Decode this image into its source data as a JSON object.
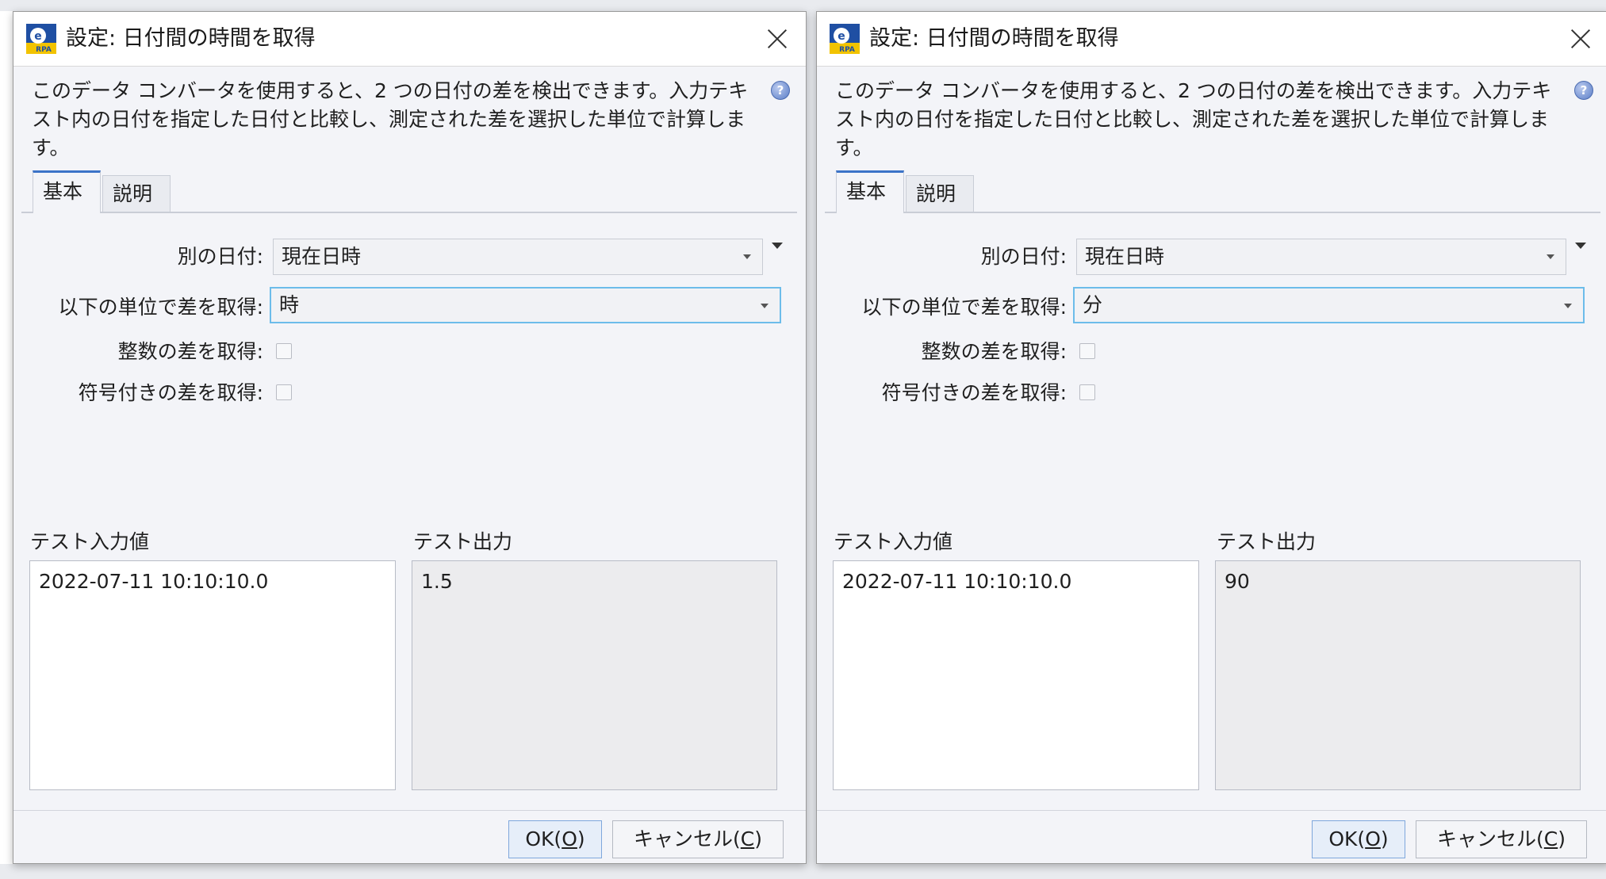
{
  "dialogs": [
    {
      "title": "設定: 日付間の時間を取得",
      "description": "このデータ コンバータを使用すると、2 つの日付の差を検出できます。入力テキスト内の日付を指定した日付と比較し、測定された差を選択した単位で計算します。",
      "tabs": [
        {
          "label": "基本",
          "active": true
        },
        {
          "label": "説明",
          "active": false
        }
      ],
      "other_date_label": "別の日付:",
      "other_date_value": "現在日時",
      "unit_label": "以下の単位で差を取得:",
      "unit_value": "時",
      "integer_diff_label": "整数の差を取得:",
      "integer_diff_checked": false,
      "signed_diff_label": "符号付きの差を取得:",
      "signed_diff_checked": false,
      "test_input_label": "テスト入力値",
      "test_input_value": "2022-07-11 10:10:10.0",
      "test_output_label": "テスト出力",
      "test_output_value": "1.5",
      "ok_label": "OK(",
      "ok_mnemonic": "O",
      "ok_suffix": ")",
      "cancel_label": "キャンセル(",
      "cancel_mnemonic": "C",
      "cancel_suffix": ")"
    },
    {
      "title": "設定: 日付間の時間を取得",
      "description": "このデータ コンバータを使用すると、2 つの日付の差を検出できます。入力テキスト内の日付を指定した日付と比較し、測定された差を選択した単位で計算します。",
      "tabs": [
        {
          "label": "基本",
          "active": true
        },
        {
          "label": "説明",
          "active": false
        }
      ],
      "other_date_label": "別の日付:",
      "other_date_value": "現在日時",
      "unit_label": "以下の単位で差を取得:",
      "unit_value": "分",
      "integer_diff_label": "整数の差を取得:",
      "integer_diff_checked": false,
      "signed_diff_label": "符号付きの差を取得:",
      "signed_diff_checked": false,
      "test_input_label": "テスト入力値",
      "test_input_value": "2022-07-11 10:10:10.0",
      "test_output_label": "テスト出力",
      "test_output_value": "90",
      "ok_label": "OK(",
      "ok_mnemonic": "O",
      "ok_suffix": ")",
      "cancel_label": "キャンセル(",
      "cancel_mnemonic": "C",
      "cancel_suffix": ")"
    }
  ],
  "colors": {
    "dialog_bg": "#f3f4f8",
    "tab_active_accent": "#3b73c8",
    "focus_border": "#6cbcea",
    "output_bg": "#ececee"
  }
}
